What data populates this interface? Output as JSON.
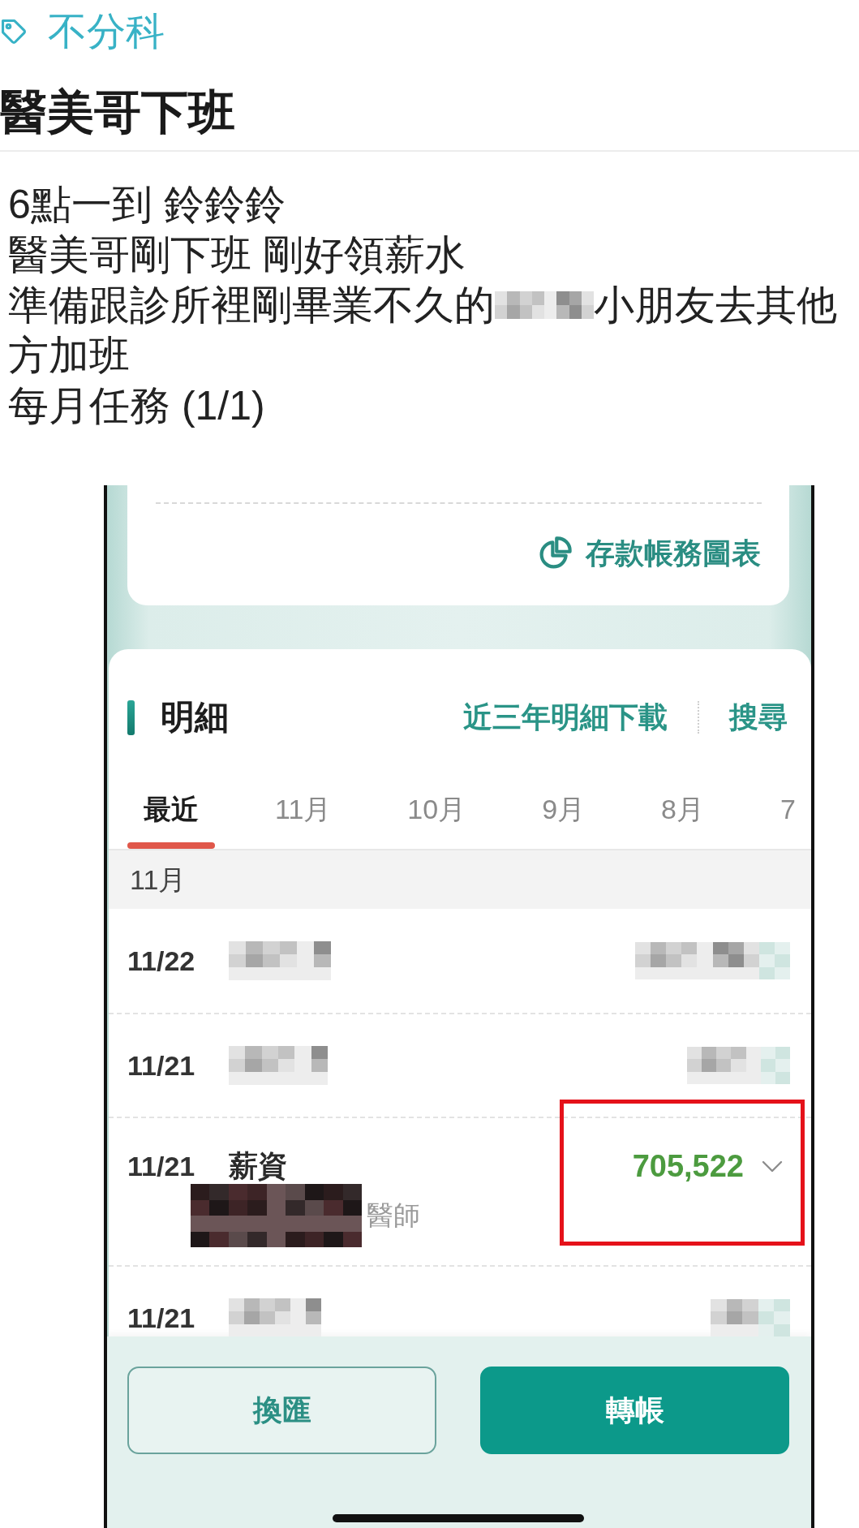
{
  "post": {
    "category": "不分科",
    "title": "醫美哥下班",
    "body_lines": [
      {
        "text": "6點一到 鈴鈴鈴",
        "redacted": false
      },
      {
        "text": "醫美哥剛下班 剛好領薪水",
        "redacted": false
      },
      {
        "text": "準備跟診所裡剛畢業不久的",
        "redacted": true,
        "text_after": "小朋友去其他"
      },
      {
        "text": "方加班",
        "redacted": false
      },
      {
        "text": "每月任務 (1/1)",
        "redacted": false
      }
    ]
  },
  "screenshot": {
    "chart_link": "存款帳務圖表",
    "details": {
      "title": "明細",
      "actions": [
        "近三年明細下載",
        "搜尋"
      ],
      "tabs": [
        {
          "label": "最近",
          "selected": true
        },
        {
          "label": "11月",
          "selected": false
        },
        {
          "label": "10月",
          "selected": false
        },
        {
          "label": "9月",
          "selected": false
        },
        {
          "label": "8月",
          "selected": false
        },
        {
          "label": "7",
          "selected": false
        }
      ],
      "section": "11月",
      "transactions": [
        {
          "date": "11/22",
          "kind": "redacted",
          "highlighted": false
        },
        {
          "date": "11/21",
          "kind": "redacted",
          "highlighted": false
        },
        {
          "date": "11/21",
          "kind": "detail",
          "description": "薪資",
          "note": "醫師",
          "amount": "705,522",
          "highlighted": true
        },
        {
          "date": "11/21",
          "kind": "redacted",
          "highlighted": false
        }
      ]
    },
    "buttons": [
      {
        "label": "換匯",
        "kind": "outline"
      },
      {
        "label": "轉帳",
        "kind": "filled"
      }
    ]
  }
}
